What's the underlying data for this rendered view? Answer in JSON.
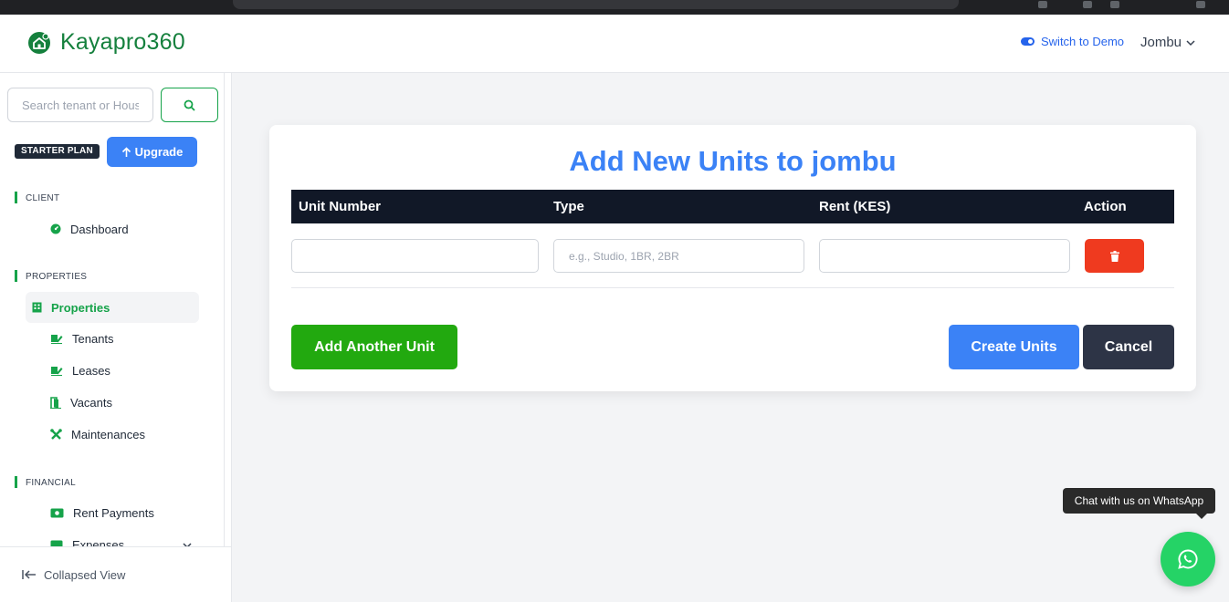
{
  "app": {
    "name": "Kayapro360"
  },
  "header": {
    "switch_label": "Switch to Demo",
    "user_name": "Jombu"
  },
  "sidebar": {
    "search_placeholder": "Search tenant or House No.",
    "plan_badge": "STARTER PLAN",
    "upgrade_label": "Upgrade",
    "sections": {
      "client": "CLIENT",
      "properties": "PROPERTIES",
      "financial": "FINANCIAL"
    },
    "items": {
      "dashboard": "Dashboard",
      "properties": "Properties",
      "tenants": "Tenants",
      "leases": "Leases",
      "vacants": "Vacants",
      "maintenances": "Maintenances",
      "rent_payments": "Rent Payments",
      "expenses": "Expenses"
    },
    "collapsed_label": "Collapsed View"
  },
  "form": {
    "title": "Add New Units to jombu",
    "columns": [
      "Unit Number",
      "Type",
      "Rent (KES)",
      "Action"
    ],
    "row": {
      "unit_number": "",
      "type": "",
      "rent": ""
    },
    "type_placeholder": "e.g., Studio, 1BR, 2BR",
    "add_label": "Add Another Unit",
    "create_label": "Create Units",
    "cancel_label": "Cancel"
  },
  "whatsapp": {
    "tooltip": "Chat with us on WhatsApp"
  },
  "colors": {
    "brand_green": "#15803d",
    "accent_blue": "#3b82f6",
    "add_green": "#22a90f",
    "delete_red": "#ef3a1f",
    "cancel_dark": "#2d3446",
    "whatsapp": "#25d366"
  }
}
